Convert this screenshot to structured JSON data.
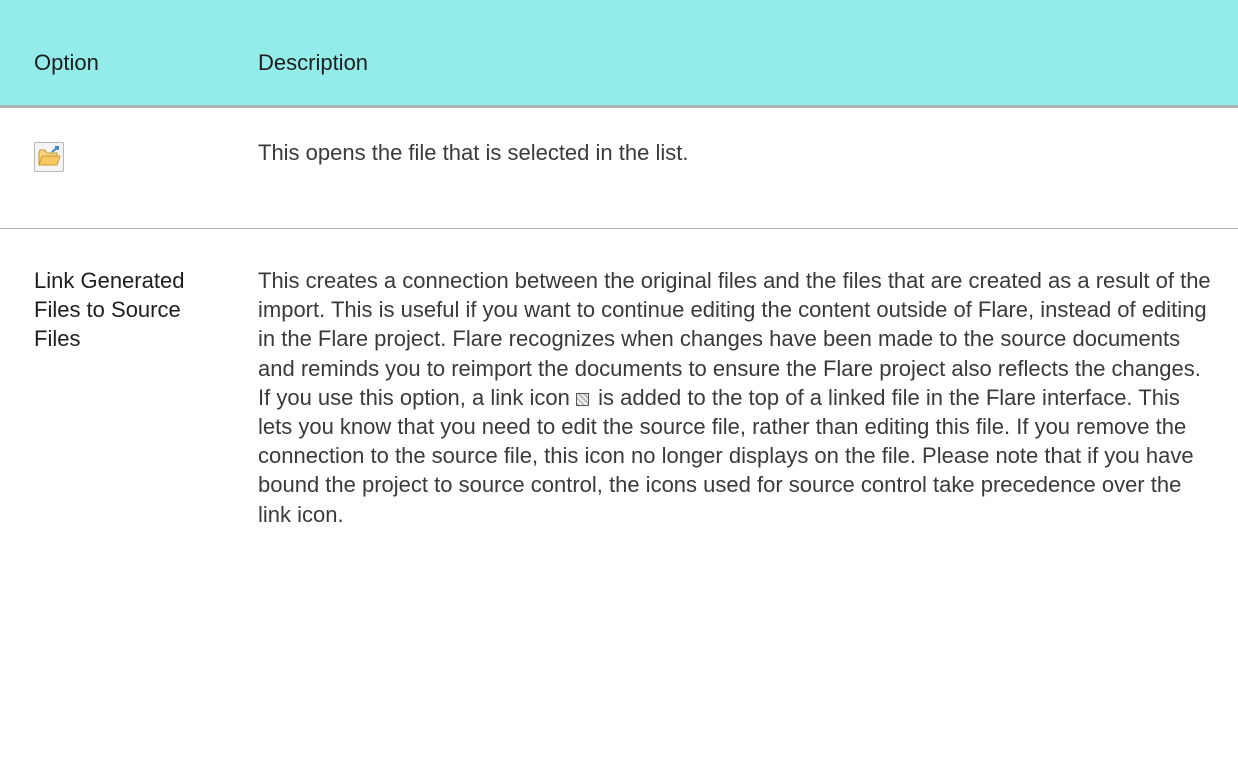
{
  "table": {
    "headers": {
      "option": "Option",
      "description": "Description"
    },
    "rows": [
      {
        "icon": "open-folder-icon",
        "description": "This opens the file that is selected in the list."
      },
      {
        "option": "Link Generated Files to Source Files",
        "description_before_icon": "This creates a connection between the original files and the files that are created as a result of the import. This is useful if you want to continue editing the content outside of Flare, instead of editing in the Flare project. Flare recognizes when changes have been made to the source documents and reminds you to reimport the documents to ensure the Flare project also reflects the changes. If you use this option, a link icon",
        "inline_icon": "link-icon",
        "description_after_icon": "is added to the top of a linked file in the Flare interface. This lets you know that you need to edit the source file, rather than editing this file. If you remove the connection to the source file, this icon no longer displays on the file. Please note that if you have bound the project to source control, the icons used for source control take precedence over the link icon."
      }
    ]
  },
  "colors": {
    "header_background": "#93ecea",
    "divider": "#a9b1b3",
    "text": "#3a3a3a"
  }
}
